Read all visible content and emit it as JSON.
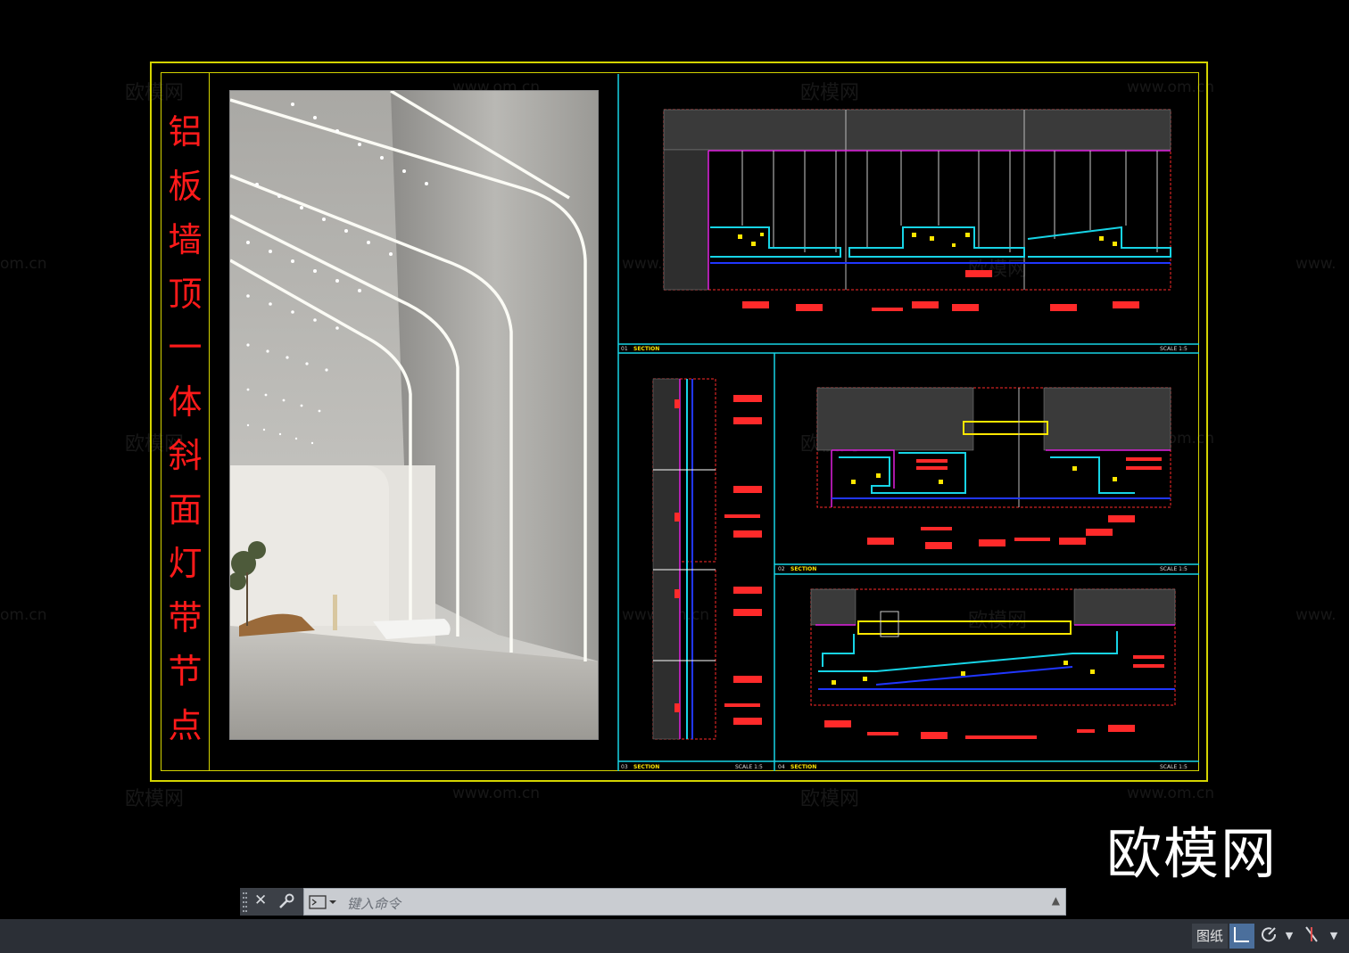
{
  "sheet": {
    "title_chars": [
      "铝",
      "板",
      "墙",
      "顶",
      "一",
      "体",
      "斜",
      "面",
      "灯",
      "带",
      "节",
      "点"
    ]
  },
  "sections": [
    {
      "num": "01",
      "label": "SECTION",
      "scale": "SCALE 1:5"
    },
    {
      "num": "02",
      "label": "SECTION",
      "scale": "SCALE 1:5"
    },
    {
      "num": "03",
      "label": "SECTION",
      "scale": "SCALE 1:5"
    },
    {
      "num": "04",
      "label": "SECTION",
      "scale": "SCALE 1:5"
    }
  ],
  "watermarks": {
    "brand": "欧模网",
    "url": "www.om.cn",
    "url_partial_left": "om.cn",
    "url_partial_right": "www."
  },
  "logo": "欧模网",
  "command_line": {
    "placeholder": "键入命令"
  },
  "statusbar": {
    "model_label": "图纸"
  },
  "colors": {
    "frame": "#d4d400",
    "title": "#ff1a1a",
    "divider": "#17d4e6"
  },
  "icons": [
    "close-icon",
    "wrench-icon",
    "terminal-icon",
    "chevron-up-icon",
    "grid-snap-icon",
    "polar-tracking-icon",
    "ortho-icon",
    "chevron-down-icon"
  ]
}
